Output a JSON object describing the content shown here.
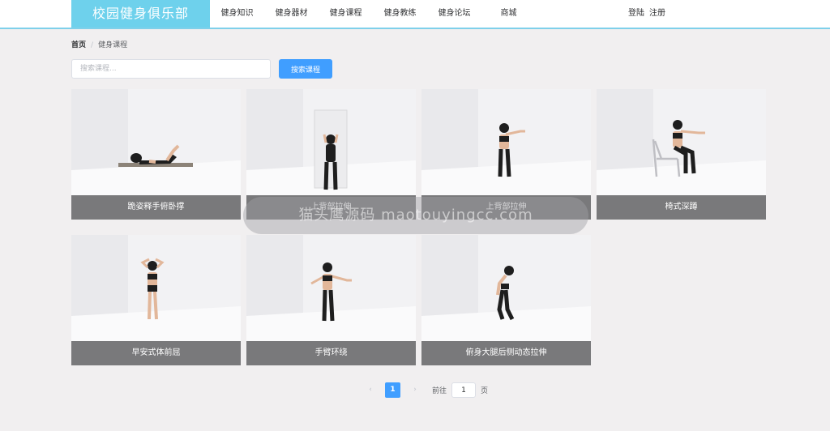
{
  "header": {
    "logo": "校园健身俱乐部",
    "nav": [
      "健身知识",
      "健身器材",
      "健身课程",
      "健身教练",
      "健身论坛",
      "商城"
    ],
    "login": "登陆",
    "register": "注册"
  },
  "breadcrumb": {
    "home": "首页",
    "separator": "/",
    "current": "健身课程"
  },
  "search": {
    "placeholder": "搜索课程...",
    "value": "",
    "button": "搜索课程"
  },
  "courses": [
    {
      "title": "跪姿释手俯卧撑",
      "pose": "prone-pushup"
    },
    {
      "title": "上背部拉伸",
      "pose": "back-stretch-wall"
    },
    {
      "title": "上背部拉伸",
      "pose": "standing-arms-forward"
    },
    {
      "title": "椅式深蹲",
      "pose": "chair-squat"
    },
    {
      "title": "早安式体前屈",
      "pose": "hands-behind-head"
    },
    {
      "title": "手臂环绕",
      "pose": "arm-circles"
    },
    {
      "title": "俯身大腿后侧动态拉伸",
      "pose": "bent-over-stretch"
    }
  ],
  "pagination": {
    "prev": "‹",
    "current": "1",
    "next": "›",
    "goto_label": "前往",
    "goto_value": "1",
    "page_suffix": "页"
  },
  "watermark": "猫头鹰源码 maotouyingcc.com",
  "colors": {
    "accent": "#409eff",
    "logo_bg": "#6ed1ec",
    "caption_bg": "#6e6e70"
  }
}
